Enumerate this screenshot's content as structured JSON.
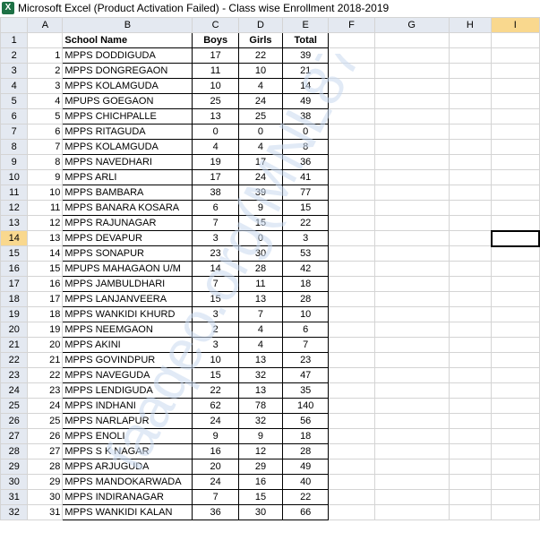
{
  "window": {
    "title": "Microsoft Excel (Product Activation Failed) - Class wise Enrollment  2018-2019"
  },
  "columns": [
    "A",
    "B",
    "C",
    "D",
    "E",
    "F",
    "G",
    "H",
    "I"
  ],
  "selected_column": "I",
  "selected_row": 14,
  "header_row": {
    "row_number": 1,
    "school_label": "School Name",
    "boys_label": "Boys",
    "girls_label": "Girls",
    "total_label": "Total"
  },
  "rows": [
    {
      "row": 2,
      "sl": 1,
      "name": "MPPS DODDIGUDA",
      "boys": 17,
      "girls": 22,
      "total": 39
    },
    {
      "row": 3,
      "sl": 2,
      "name": "MPPS DONGREGAON",
      "boys": 11,
      "girls": 10,
      "total": 21
    },
    {
      "row": 4,
      "sl": 3,
      "name": "MPPS KOLAMGUDA",
      "boys": 10,
      "girls": 4,
      "total": 14
    },
    {
      "row": 5,
      "sl": 4,
      "name": "MPUPS GOEGAON",
      "boys": 25,
      "girls": 24,
      "total": 49
    },
    {
      "row": 6,
      "sl": 5,
      "name": "MPPS CHICHPALLE",
      "boys": 13,
      "girls": 25,
      "total": 38
    },
    {
      "row": 7,
      "sl": 6,
      "name": "MPPS RITAGUDA",
      "boys": 0,
      "girls": 0,
      "total": 0
    },
    {
      "row": 8,
      "sl": 7,
      "name": "MPPS KOLAMGUDA",
      "boys": 4,
      "girls": 4,
      "total": 8
    },
    {
      "row": 9,
      "sl": 8,
      "name": "MPPS NAVEDHARI",
      "boys": 19,
      "girls": 17,
      "total": 36
    },
    {
      "row": 10,
      "sl": 9,
      "name": "MPPS ARLI",
      "boys": 17,
      "girls": 24,
      "total": 41
    },
    {
      "row": 11,
      "sl": 10,
      "name": "MPPS BAMBARA",
      "boys": 38,
      "girls": 39,
      "total": 77
    },
    {
      "row": 12,
      "sl": 11,
      "name": "MPPS BANARA KOSARA",
      "boys": 6,
      "girls": 9,
      "total": 15
    },
    {
      "row": 13,
      "sl": 12,
      "name": "MPPS RAJUNAGAR",
      "boys": 7,
      "girls": 15,
      "total": 22
    },
    {
      "row": 14,
      "sl": 13,
      "name": "MPPS DEVAPUR",
      "boys": 3,
      "girls": 0,
      "total": 3
    },
    {
      "row": 15,
      "sl": 14,
      "name": "MPPS SONAPUR",
      "boys": 23,
      "girls": 30,
      "total": 53
    },
    {
      "row": 16,
      "sl": 15,
      "name": "MPUPS MAHAGAON U/M",
      "boys": 14,
      "girls": 28,
      "total": 42
    },
    {
      "row": 17,
      "sl": 16,
      "name": "MPPS JAMBULDHARI",
      "boys": 7,
      "girls": 11,
      "total": 18
    },
    {
      "row": 18,
      "sl": 17,
      "name": "MPPS LANJANVEERA",
      "boys": 15,
      "girls": 13,
      "total": 28
    },
    {
      "row": 19,
      "sl": 18,
      "name": "MPPS WANKIDI KHURD",
      "boys": 3,
      "girls": 7,
      "total": 10
    },
    {
      "row": 20,
      "sl": 19,
      "name": "MPPS NEEMGAON",
      "boys": 2,
      "girls": 4,
      "total": 6
    },
    {
      "row": 21,
      "sl": 20,
      "name": "MPPS AKINI",
      "boys": 3,
      "girls": 4,
      "total": 7
    },
    {
      "row": 22,
      "sl": 21,
      "name": "MPPS GOVINDPUR",
      "boys": 10,
      "girls": 13,
      "total": 23
    },
    {
      "row": 23,
      "sl": 22,
      "name": "MPPS NAVEGUDA",
      "boys": 15,
      "girls": 32,
      "total": 47
    },
    {
      "row": 24,
      "sl": 23,
      "name": "MPPS LENDIGUDA",
      "boys": 22,
      "girls": 13,
      "total": 35
    },
    {
      "row": 25,
      "sl": 24,
      "name": "MPPS INDHANI",
      "boys": 62,
      "girls": 78,
      "total": 140
    },
    {
      "row": 26,
      "sl": 25,
      "name": "MPPS NARLAPUR",
      "boys": 24,
      "girls": 32,
      "total": 56
    },
    {
      "row": 27,
      "sl": 26,
      "name": "MPPS ENOLI",
      "boys": 9,
      "girls": 9,
      "total": 18
    },
    {
      "row": 28,
      "sl": 27,
      "name": "MPPS S K NAGAR",
      "boys": 16,
      "girls": 12,
      "total": 28
    },
    {
      "row": 29,
      "sl": 28,
      "name": "MPPS ARJUGUDA",
      "boys": 20,
      "girls": 29,
      "total": 49
    },
    {
      "row": 30,
      "sl": 29,
      "name": "MPPS MANDOKARWADA",
      "boys": 24,
      "girls": 16,
      "total": 40
    },
    {
      "row": 31,
      "sl": 30,
      "name": "MPPS INDIRANAGAR",
      "boys": 7,
      "girls": 15,
      "total": 22
    },
    {
      "row": 32,
      "sl": 31,
      "name": "MPPS WANKIDI KALAN",
      "boys": 36,
      "girls": 30,
      "total": 66
    }
  ],
  "colors": {
    "header_bg": "#e4e9f1",
    "selected_header_bg": "#f9d88e",
    "gridline": "#d4d4d4",
    "watermark": "#c9d8ee"
  }
}
